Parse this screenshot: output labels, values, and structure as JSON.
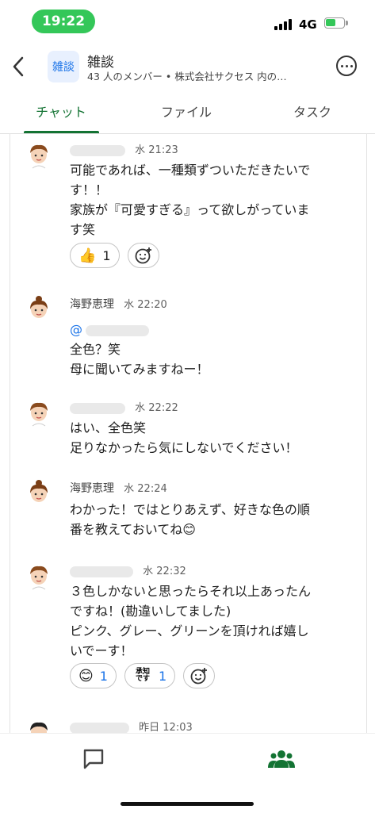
{
  "status_bar": {
    "time": "19:22",
    "network": "4G"
  },
  "header": {
    "avatar_text": "雑談",
    "title": "雑談",
    "subtitle": "43 人のメンバー • 株式会社サクセス 内の…"
  },
  "tabs": [
    {
      "label": "チャット",
      "active": true
    },
    {
      "label": "ファイル",
      "active": false
    },
    {
      "label": "タスク",
      "active": false
    }
  ],
  "messages": [
    {
      "sender": "",
      "time": "水 21:23",
      "lines": [
        "可能であれば、一種類ずついただきたいで",
        "す！！",
        "家族が『可愛すぎる』って欲しがっていま",
        "す笑"
      ],
      "reactions": [
        {
          "emoji": "👍",
          "count": "1"
        }
      ]
    },
    {
      "sender": "海野恵理",
      "time": "水 22:20",
      "mention": "@",
      "lines": [
        "全色？笑",
        "母に聞いてみますねー！"
      ]
    },
    {
      "sender": "",
      "time": "水 22:22",
      "lines": [
        "はい、全色笑",
        "足りなかったら気にしないでください！"
      ]
    },
    {
      "sender": "海野恵理",
      "time": "水 22:24",
      "lines": [
        "わかった！ではとりあえず、好きな色の順",
        "番を教えておいてね😊"
      ]
    },
    {
      "sender": "",
      "time": "水 22:32",
      "lines": [
        "３色しかないと思ったらそれ以上あったん",
        "ですね！(勘違いしてました)",
        "ピンク、グレー、グリーンを頂ければ嬉し",
        "いでーす！"
      ],
      "reactions": [
        {
          "emoji": "😊",
          "count": "1"
        },
        {
          "stamp_line1": "承知",
          "stamp_line2": "です",
          "count": "1"
        }
      ]
    },
    {
      "sender": "",
      "time": "昨日 12:03"
    }
  ],
  "colors": {
    "accent": "#137333",
    "link": "#1a73e8",
    "status_green": "#34c759"
  }
}
